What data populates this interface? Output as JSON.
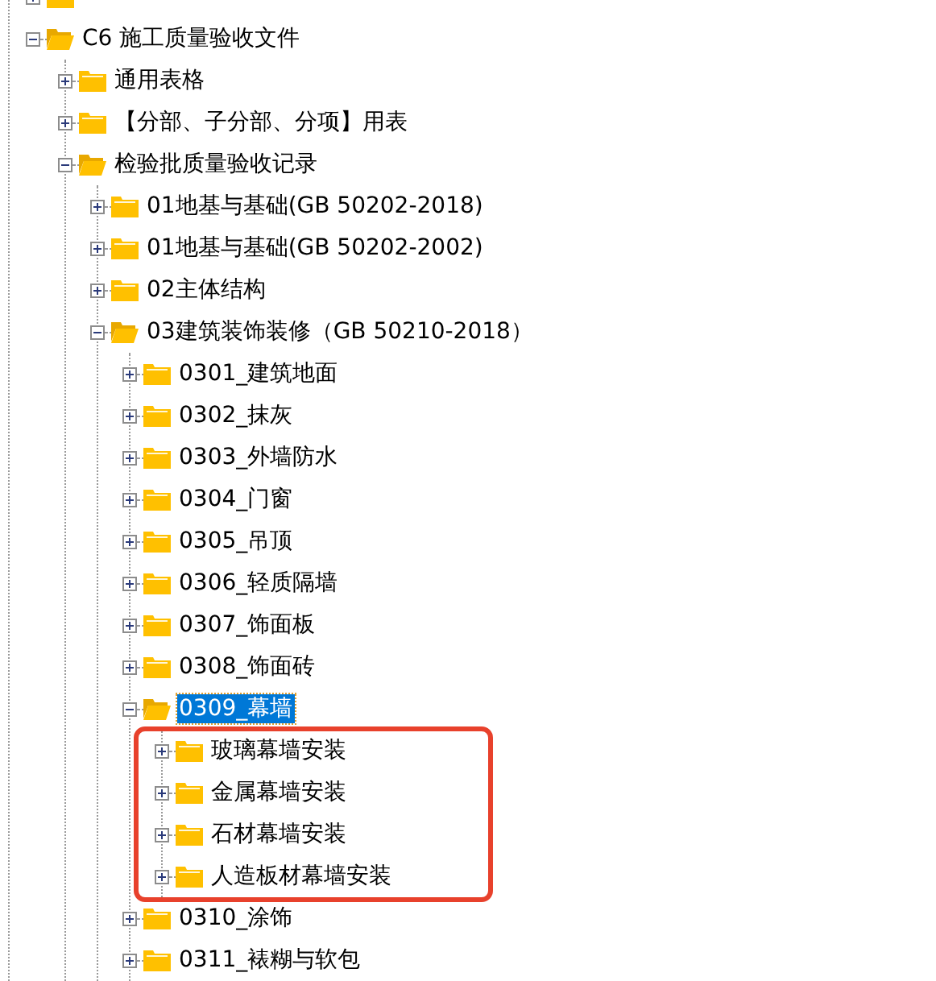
{
  "tree": [
    {
      "expanded": false
    },
    {
      "label": "C6 施工质量验收文件",
      "expanded": true,
      "selected": false,
      "children": [
        {
          "label": "通用表格",
          "expanded": false,
          "selected": false
        },
        {
          "label": "【分部、子分部、分项】用表",
          "expanded": false,
          "selected": false
        },
        {
          "label": "检验批质量验收记录",
          "expanded": true,
          "selected": false,
          "children": [
            {
              "label": "01地基与基础(GB 50202-2018)",
              "expanded": false,
              "selected": false
            },
            {
              "label": "01地基与基础(GB 50202-2002)",
              "expanded": false,
              "selected": false
            },
            {
              "label": "02主体结构",
              "expanded": false,
              "selected": false
            },
            {
              "label": "03建筑装饰装修（GB 50210-2018）",
              "expanded": true,
              "selected": false,
              "children": [
                {
                  "label": "0301_建筑地面",
                  "expanded": false,
                  "selected": false
                },
                {
                  "label": "0302_抹灰",
                  "expanded": false,
                  "selected": false
                },
                {
                  "label": "0303_外墙防水",
                  "expanded": false,
                  "selected": false
                },
                {
                  "label": "0304_门窗",
                  "expanded": false,
                  "selected": false
                },
                {
                  "label": "0305_吊顶",
                  "expanded": false,
                  "selected": false
                },
                {
                  "label": "0306_轻质隔墙",
                  "expanded": false,
                  "selected": false
                },
                {
                  "label": "0307_饰面板",
                  "expanded": false,
                  "selected": false
                },
                {
                  "label": "0308_饰面砖",
                  "expanded": false,
                  "selected": false
                },
                {
                  "label": "0309_幕墙",
                  "expanded": true,
                  "selected": true,
                  "children": [
                    {
                      "label": "玻璃幕墙安装",
                      "expanded": false,
                      "selected": false
                    },
                    {
                      "label": "金属幕墙安装",
                      "expanded": false,
                      "selected": false
                    },
                    {
                      "label": "石材幕墙安装",
                      "expanded": false,
                      "selected": false
                    },
                    {
                      "label": "人造板材幕墙安装",
                      "expanded": false,
                      "selected": false
                    }
                  ]
                },
                {
                  "label": "0310_涂饰",
                  "expanded": false,
                  "selected": false
                },
                {
                  "label": "0311_裱糊与软包",
                  "expanded": false,
                  "selected": false
                }
              ]
            }
          ]
        }
      ]
    }
  ]
}
